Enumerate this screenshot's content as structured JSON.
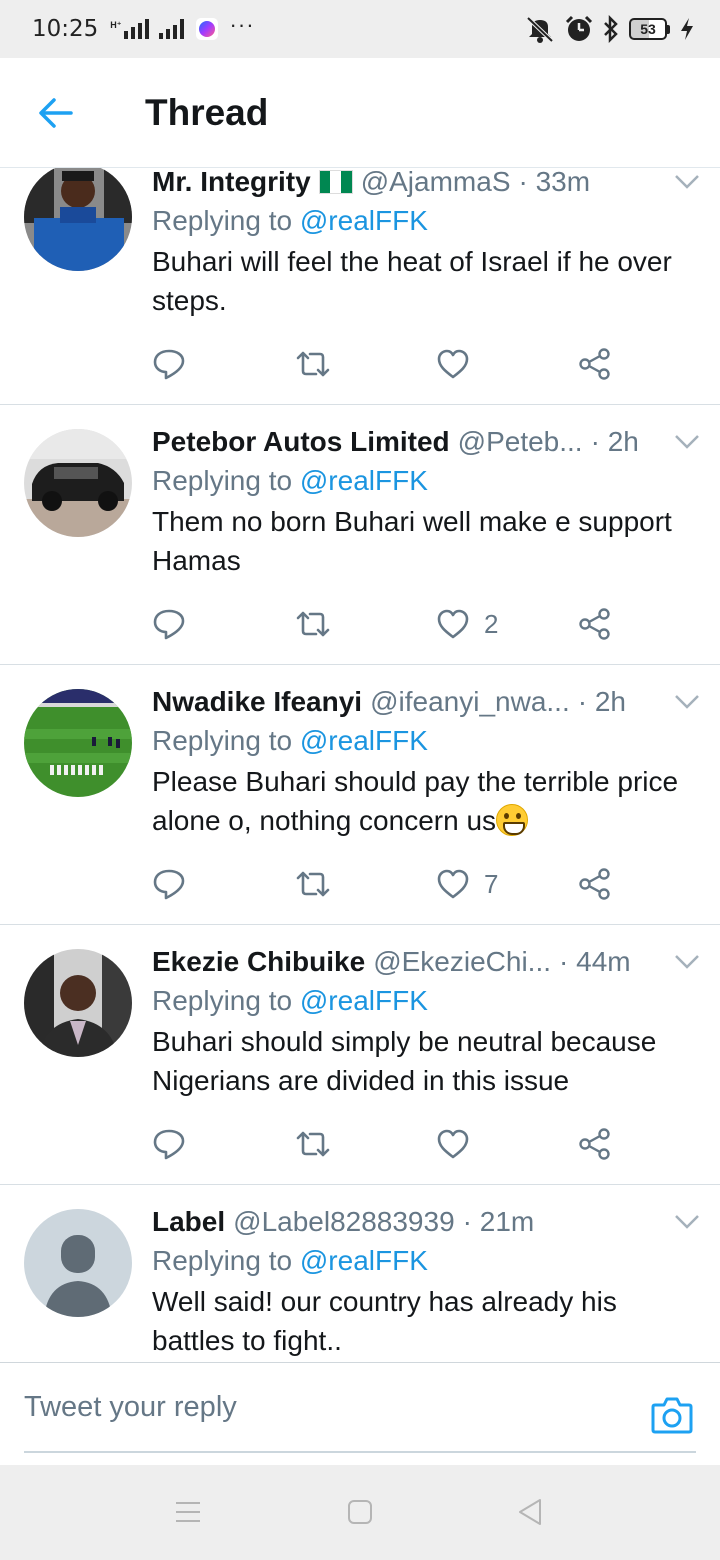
{
  "status_bar": {
    "time": "10:25",
    "network_label": "H⁺",
    "more_dots": "···",
    "battery_level": "53"
  },
  "header": {
    "title": "Thread"
  },
  "colors": {
    "accent": "#1da1f2",
    "mention": "#1b95e0",
    "secondary_text": "#657786"
  },
  "tweets": [
    {
      "name": "Mr. Integrity",
      "has_flag": "nigeria-flag-emoji",
      "handle": "@AjammaS",
      "time": "· 33m",
      "replying_prefix": "Replying to ",
      "replying_to": "@realFFK",
      "text": "Buhari will feel the heat of Israel if he over steps.",
      "like_count": ""
    },
    {
      "name": "Petebor Autos Limited",
      "handle": "@Peteb...",
      "time": "· 2h",
      "replying_prefix": "Replying to ",
      "replying_to": "@realFFK",
      "text": "Them no born Buhari well make e support Hamas",
      "like_count": "2"
    },
    {
      "name": "Nwadike Ifeanyi",
      "handle": "@ifeanyi_nwa...",
      "time": "· 2h",
      "replying_prefix": "Replying to ",
      "replying_to": "@realFFK",
      "text": "Please Buhari should pay the terrible price alone o, nothing concern us",
      "text_emoji": "grinning-face-emoji",
      "like_count": "7"
    },
    {
      "name": "Ekezie Chibuike",
      "handle": "@EkezieChi...",
      "time": "· 44m",
      "replying_prefix": "Replying to ",
      "replying_to": "@realFFK",
      "text": "Buhari should simply be neutral because Nigerians are divided in this issue",
      "like_count": ""
    },
    {
      "name": "Label",
      "handle": "@Label82883939",
      "time": "· 21m",
      "replying_prefix": "Replying to ",
      "replying_to": "@realFFK",
      "text": "Well said! our country has already his battles to fight..",
      "like_count": ""
    }
  ],
  "reply_bar": {
    "placeholder": "Tweet your reply"
  }
}
